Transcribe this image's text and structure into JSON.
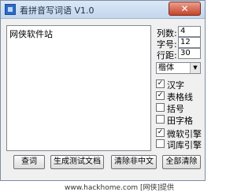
{
  "window": {
    "title": "看拼音写词语 V1.0"
  },
  "editor": {
    "text": "网侠软件站"
  },
  "settings": {
    "columns_label": "列数:",
    "columns_value": "4",
    "font_size_label": "字号:",
    "font_size_value": "12",
    "line_spacing_label": "行距:",
    "line_spacing_value": "30",
    "font_select": "楷体"
  },
  "options": [
    {
      "label": "汉字",
      "checked": true
    },
    {
      "label": "表格线",
      "checked": true
    },
    {
      "label": "括号",
      "checked": false
    },
    {
      "label": "田字格",
      "checked": false
    },
    {
      "label": "微软引擎",
      "checked": true
    },
    {
      "label": "词库引擎",
      "checked": false
    }
  ],
  "buttons": {
    "query": "查词",
    "generate": "生成测试文档",
    "clear_non_chinese": "清除非中文",
    "clear_all": "全部清除"
  },
  "close_glyph": "✕",
  "checkmark_glyph": "✓",
  "watermark": "www.hackhome.com [网侠]提供"
}
